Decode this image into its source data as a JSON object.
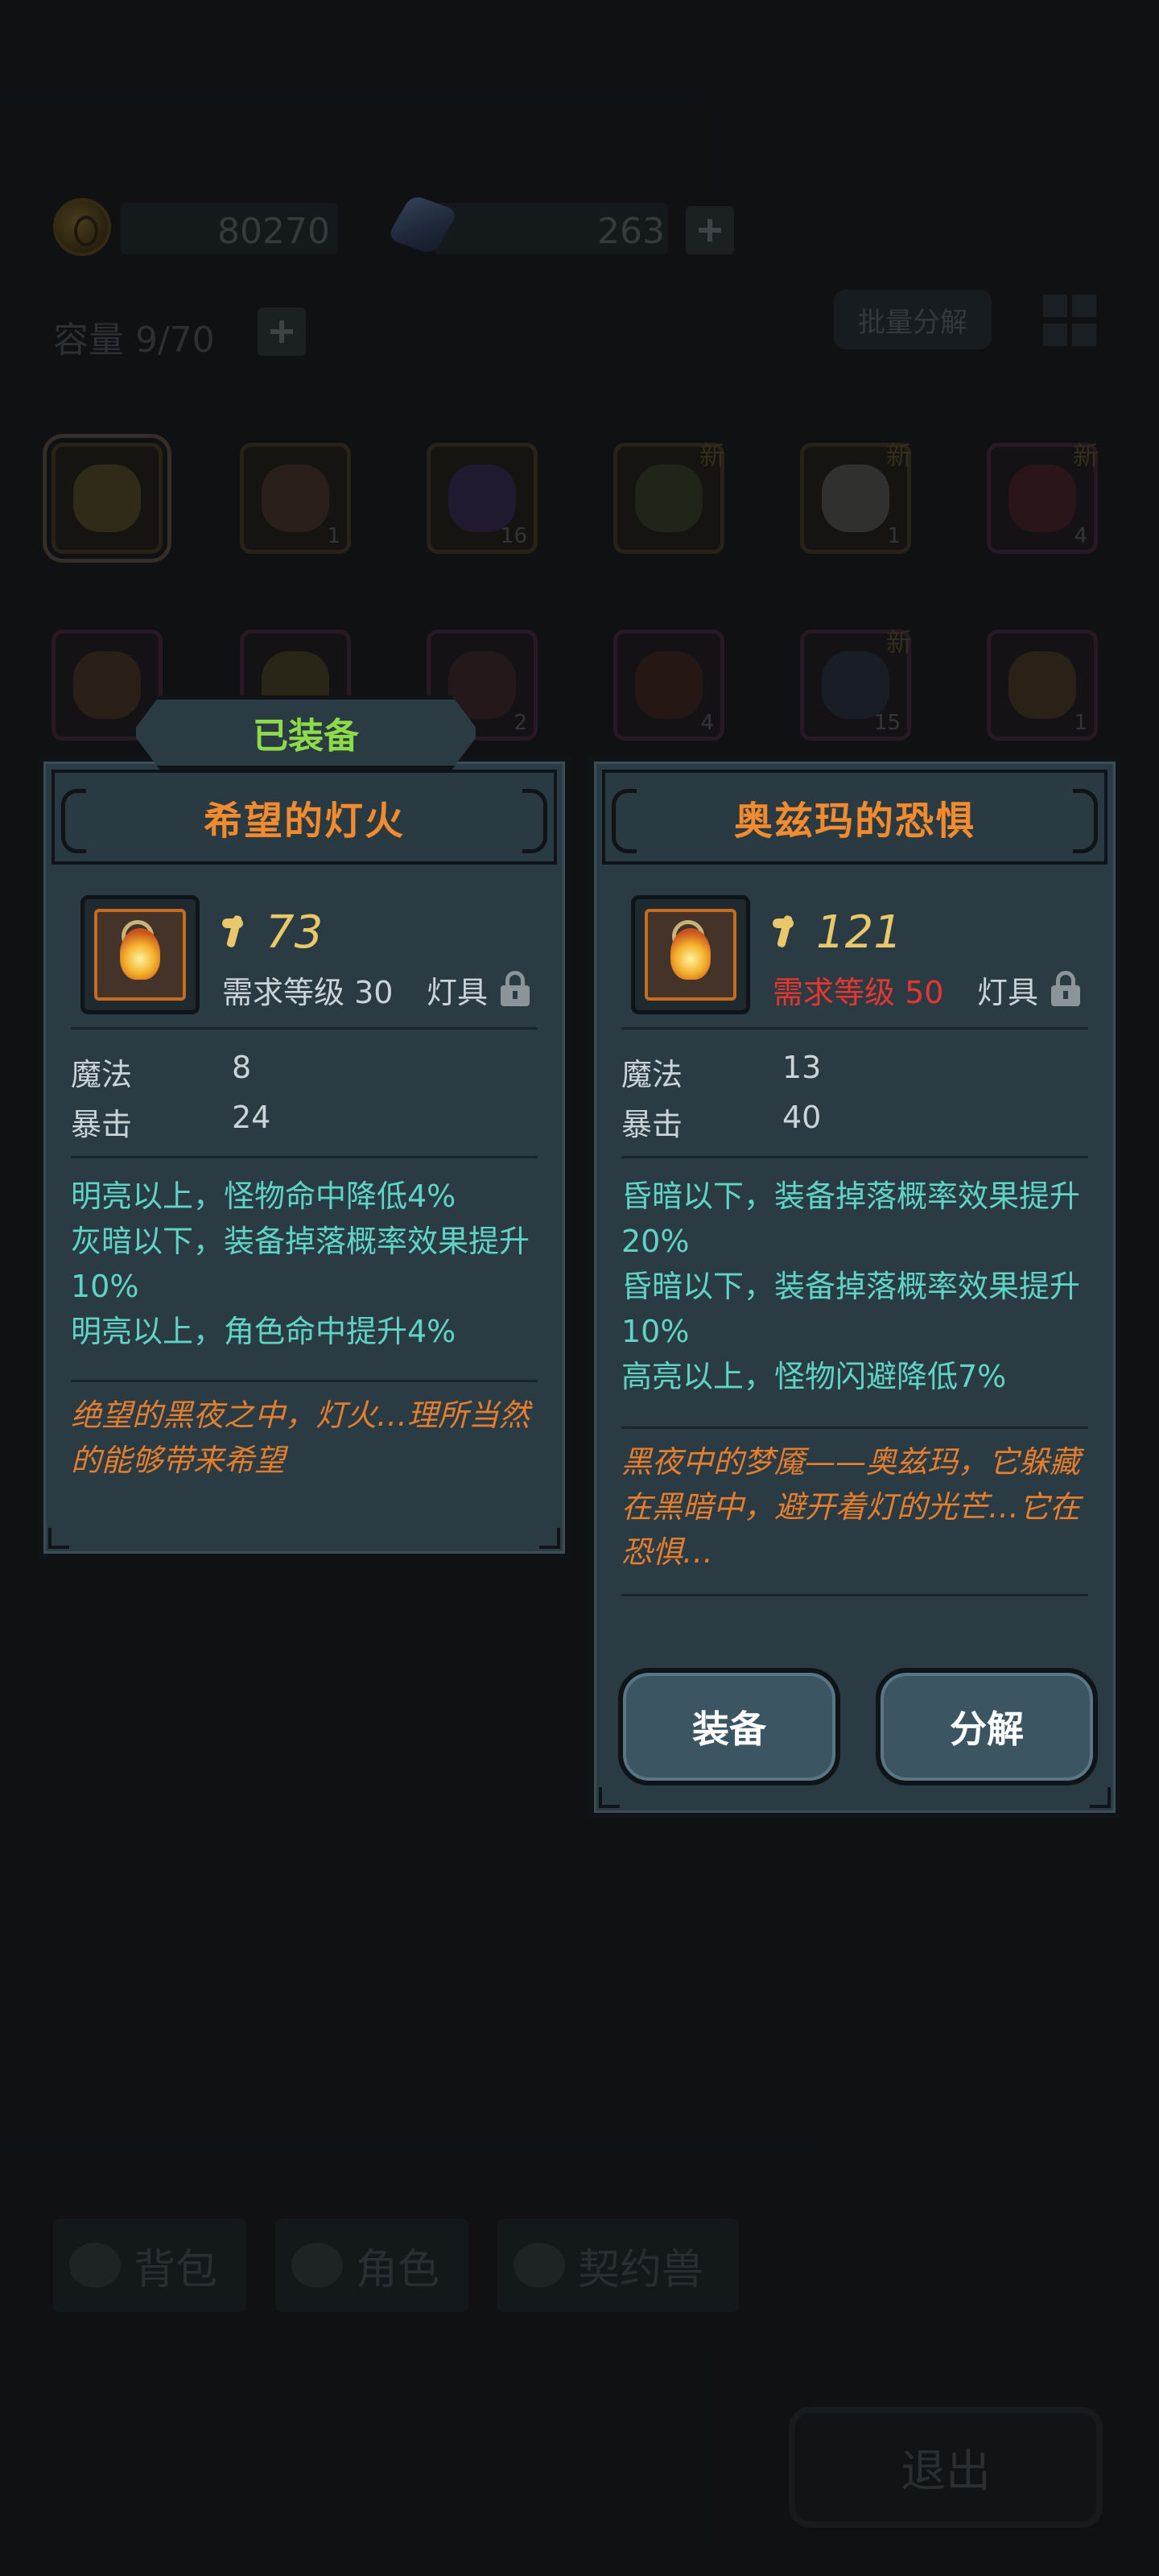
{
  "resources": {
    "gold": "80270",
    "crystals": "263",
    "capacity": "容量 9/70",
    "batch_button": "批量分解"
  },
  "inventory": [
    {
      "count": "",
      "new": "",
      "kind": "gold",
      "art_color": "#6a5a2a"
    },
    {
      "count": "1",
      "new": "",
      "kind": "gold",
      "art_color": "#5a3a30"
    },
    {
      "count": "16",
      "new": "",
      "kind": "gold",
      "art_color": "#3c2a6a"
    },
    {
      "count": "",
      "new": "新",
      "kind": "gold",
      "art_color": "#3a4a2a"
    },
    {
      "count": "1",
      "new": "新",
      "kind": "gold",
      "art_color": "#6a6a6a"
    },
    {
      "count": "4",
      "new": "新",
      "kind": "purple",
      "art_color": "#5a2222"
    },
    {
      "count": "",
      "new": "",
      "kind": "purple",
      "art_color": "#5a4020"
    },
    {
      "count": "",
      "new": "",
      "kind": "purple",
      "art_color": "#5a5020"
    },
    {
      "count": "2",
      "new": "",
      "kind": "purple",
      "art_color": "#4a2a2a"
    },
    {
      "count": "4",
      "new": "",
      "kind": "purple",
      "art_color": "#4a2a1a"
    },
    {
      "count": "15",
      "new": "新",
      "kind": "purple",
      "art_color": "#2a3a4a"
    },
    {
      "count": "1",
      "new": "",
      "kind": "purple",
      "art_color": "#5a4420"
    }
  ],
  "tabs": [
    "背包",
    "角色",
    "契约兽"
  ],
  "exit_button": "退出",
  "equipped_label": "已装备",
  "equipped_item": {
    "name": "希望的灯火",
    "power": "73",
    "requirement": "需求等级 30",
    "slot_type": "灯具",
    "stats": [
      {
        "name": "魔法",
        "value": "8"
      },
      {
        "name": "暴击",
        "value": "24"
      }
    ],
    "effects": [
      "明亮以上，怪物命中降低4%",
      "灰暗以下，装备掉落概率效果提升10%",
      "明亮以上，角色命中提升4%"
    ],
    "flavor": "绝望的黑夜之中，灯火…理所当然的能够带来希望"
  },
  "new_item": {
    "name": "奥兹玛的恐惧",
    "power": "121",
    "requirement": "需求等级 50",
    "slot_type": "灯具",
    "stats": [
      {
        "name": "魔法",
        "value": "13"
      },
      {
        "name": "暴击",
        "value": "40"
      }
    ],
    "effects": [
      "昏暗以下，装备掉落概率效果提升20%",
      "昏暗以下，装备掉落概率效果提升10%",
      "高亮以上，怪物闪避降低7%"
    ],
    "flavor": "黑夜中的梦魇——奥兹玛，它躲藏在黑暗中，避开着灯的光芒…它在恐惧…",
    "equip_button": "装备",
    "dismantle_button": "分解"
  },
  "colors": {
    "title": "#f28a2e",
    "effect_text": "#5fd4c4",
    "flavor_text": "#e47e2e",
    "requirement_unmet": "#e8362f",
    "equipped_badge": "#8edb4a",
    "power": "#e8c86a"
  }
}
